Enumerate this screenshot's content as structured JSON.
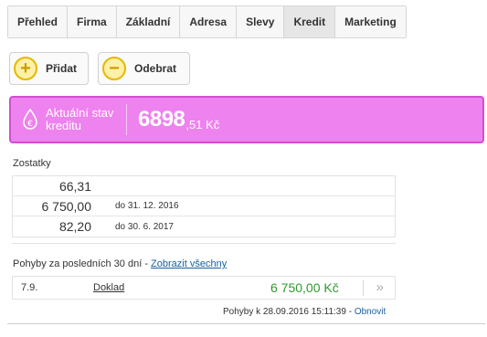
{
  "tabs": [
    {
      "label": "Přehled"
    },
    {
      "label": "Firma"
    },
    {
      "label": "Základní"
    },
    {
      "label": "Adresa"
    },
    {
      "label": "Slevy"
    },
    {
      "label": "Kredit",
      "active": true
    },
    {
      "label": "Marketing"
    }
  ],
  "actions": {
    "add_label": "Přidat",
    "remove_label": "Odebrat"
  },
  "credit": {
    "label": "Aktuální stav kreditu",
    "amount_main": "6898",
    "amount_fraction": ",51 Kč",
    "color": "#ee82ee"
  },
  "remainders": {
    "title": "Zostatky",
    "rows": [
      {
        "amount": "66,31",
        "note": ""
      },
      {
        "amount": "6 750,00",
        "note": "do 31. 12. 2016"
      },
      {
        "amount": "82,20",
        "note": "do 30. 6. 2017"
      }
    ]
  },
  "movements": {
    "title": "Pohyby za posledních 30 dní -",
    "show_all": "Zobrazit všechny",
    "rows": [
      {
        "date": "7.9.",
        "link": "Doklad",
        "amount": "6 750,00 Kč",
        "arrow": "»"
      }
    ]
  },
  "footer": {
    "text": "Pohyby k 28.09.2016 15:11:39 -",
    "refresh": "Obnovit"
  },
  "icons": {
    "plus": "plus-icon",
    "minus": "minus-icon",
    "euro": "euro-drop-icon"
  }
}
